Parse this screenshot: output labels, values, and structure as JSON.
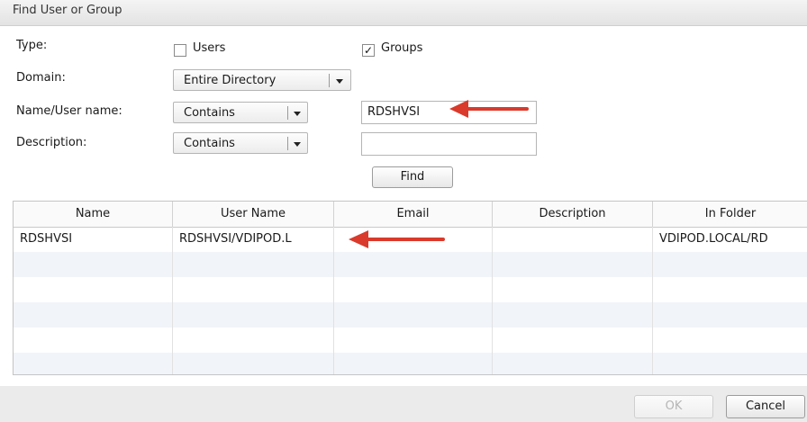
{
  "dialog": {
    "title": "Find User or Group"
  },
  "form": {
    "type_label": "Type:",
    "type_options": [
      {
        "label": "Users",
        "checked": false
      },
      {
        "label": "Groups",
        "checked": true
      }
    ],
    "domain_label": "Domain:",
    "domain_value": "Entire Directory",
    "name_label": "Name/User name:",
    "name_match": "Contains",
    "name_value": "RDSHVSI",
    "description_label": "Description:",
    "description_match": "Contains",
    "description_value": "",
    "find_label": "Find",
    "check_glyph": "✓"
  },
  "results": {
    "columns": [
      "Name",
      "User Name",
      "Email",
      "Description",
      "In Folder"
    ],
    "rows": [
      [
        "RDSHVSI",
        "RDSHVSI/VDIPOD.L",
        "",
        "",
        "VDIPOD.LOCAL/RD"
      ]
    ]
  },
  "footer": {
    "ok_label": "OK",
    "cancel_label": "Cancel"
  },
  "colors": {
    "arrow": "#d93a2b",
    "row_alt": "#f1f4f8"
  }
}
